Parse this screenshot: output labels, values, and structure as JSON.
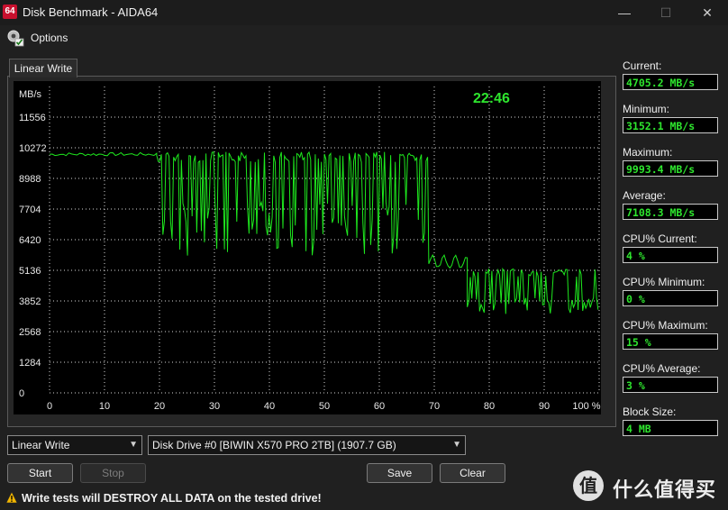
{
  "window": {
    "icon_text": "64",
    "title": "Disk Benchmark - AIDA64",
    "minimize": "—",
    "maximize": "☐",
    "close": "✕"
  },
  "menu": {
    "options_label": "Options"
  },
  "tab": {
    "label": "Linear Write"
  },
  "chart_data": {
    "type": "line",
    "ylabel": "MB/s",
    "timer": "22:46",
    "y_ticks": [
      "11556",
      "10272",
      "8988",
      "7704",
      "6420",
      "5136",
      "3852",
      "2568",
      "1284",
      "0"
    ],
    "x_ticks": [
      "0",
      "10",
      "20",
      "30",
      "40",
      "50",
      "60",
      "70",
      "80",
      "90",
      "100 %"
    ],
    "xlim": [
      0,
      100
    ],
    "ylim": [
      0,
      12840
    ],
    "grid": true,
    "line_color": "#1ee81e",
    "segments": [
      {
        "x": [
          0,
          19.5
        ],
        "level": 10000,
        "lo": 9850,
        "hi": 10080,
        "style": "flat"
      },
      {
        "x": [
          19.5,
          69
        ],
        "level": 9000,
        "lo": 5700,
        "hi": 10100,
        "style": "oscillate"
      },
      {
        "x": [
          69,
          76
        ],
        "level": 5500,
        "lo": 5200,
        "hi": 5800,
        "style": "ripple"
      },
      {
        "x": [
          76,
          100
        ],
        "level": 4300,
        "lo": 3300,
        "hi": 5200,
        "style": "oscillate"
      }
    ]
  },
  "stats": [
    {
      "label": "Current:",
      "value": "4705.2 MB/s"
    },
    {
      "label": "Minimum:",
      "value": "3152.1 MB/s"
    },
    {
      "label": "Maximum:",
      "value": "9993.4 MB/s"
    },
    {
      "label": "Average:",
      "value": "7108.3 MB/s"
    },
    {
      "label": "CPU% Current:",
      "value": "4 %"
    },
    {
      "label": "CPU% Minimum:",
      "value": "0 %"
    },
    {
      "label": "CPU% Maximum:",
      "value": "15 %"
    },
    {
      "label": "CPU% Average:",
      "value": "3 %"
    },
    {
      "label": "Block Size:",
      "value": "4 MB"
    }
  ],
  "controls": {
    "test_select": "Linear Write",
    "drive_select": "Disk Drive #0  [BIWIN X570 PRO 2TB]  (1907.7 GB)",
    "start": "Start",
    "stop": "Stop",
    "save": "Save",
    "clear": "Clear"
  },
  "warning": "Write tests will DESTROY ALL DATA on the tested drive!",
  "watermark": "什么值得买"
}
